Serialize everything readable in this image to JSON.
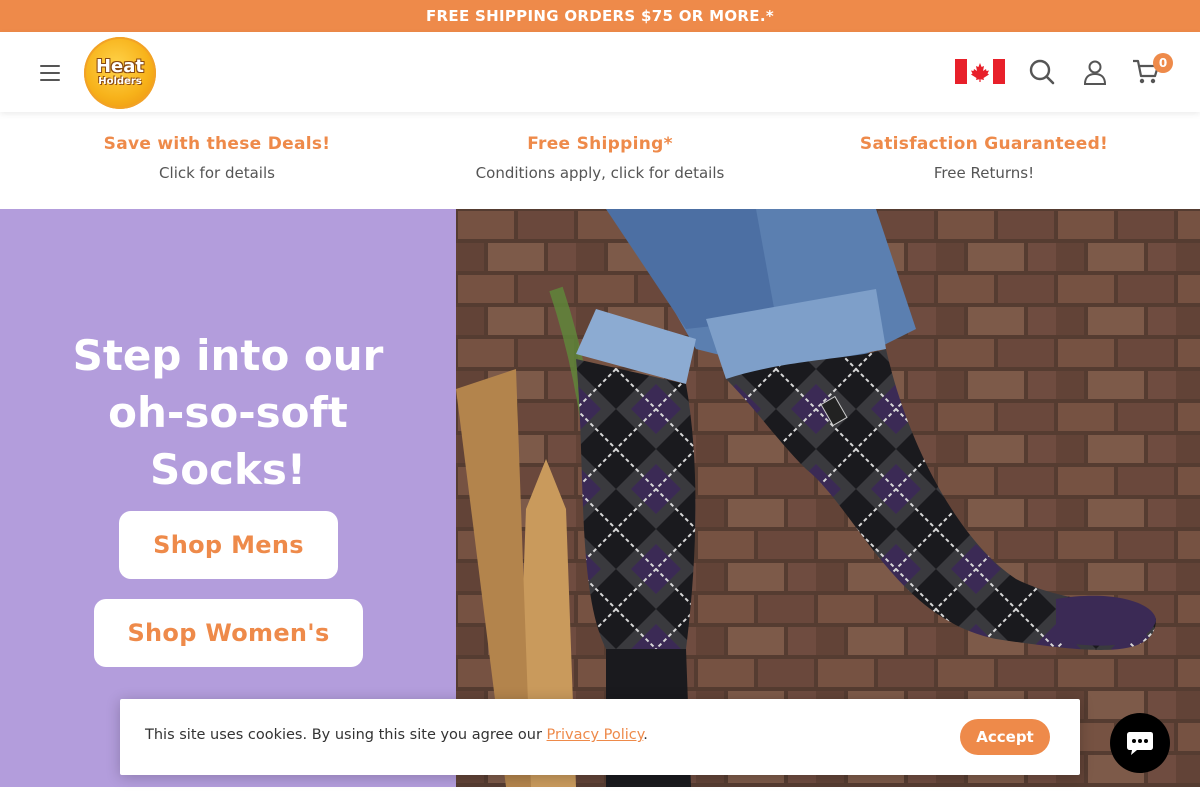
{
  "announcement": "FREE SHIPPING ORDERS $75 OR MORE.*",
  "header": {
    "logo_line1": "Heat",
    "logo_line2": "Holders",
    "cart_count": "0"
  },
  "usps": [
    {
      "title": "Save with these Deals!",
      "subtitle": "Click for details"
    },
    {
      "title": "Free Shipping*",
      "subtitle": "Conditions apply, click for details"
    },
    {
      "title": "Satisfaction Guaranteed!",
      "subtitle": "Free Returns!"
    }
  ],
  "hero": {
    "heading_line1": "Step into our",
    "heading_line2": "oh-so-soft",
    "heading_line3": "Socks!",
    "shop_mens": "Shop Mens",
    "shop_womens": "Shop Women's"
  },
  "cookie": {
    "text": "This site uses cookies. By using this site you agree our ",
    "link": "Privacy Policy",
    "after_link": ".",
    "accept": "Accept"
  },
  "colors": {
    "accent": "#ee8a4a",
    "hero_bg": "#b39ddc",
    "flag_red": "#e8202a"
  },
  "icons": [
    "menu-icon",
    "canada-flag-icon",
    "search-icon",
    "account-icon",
    "cart-icon",
    "chat-icon"
  ]
}
